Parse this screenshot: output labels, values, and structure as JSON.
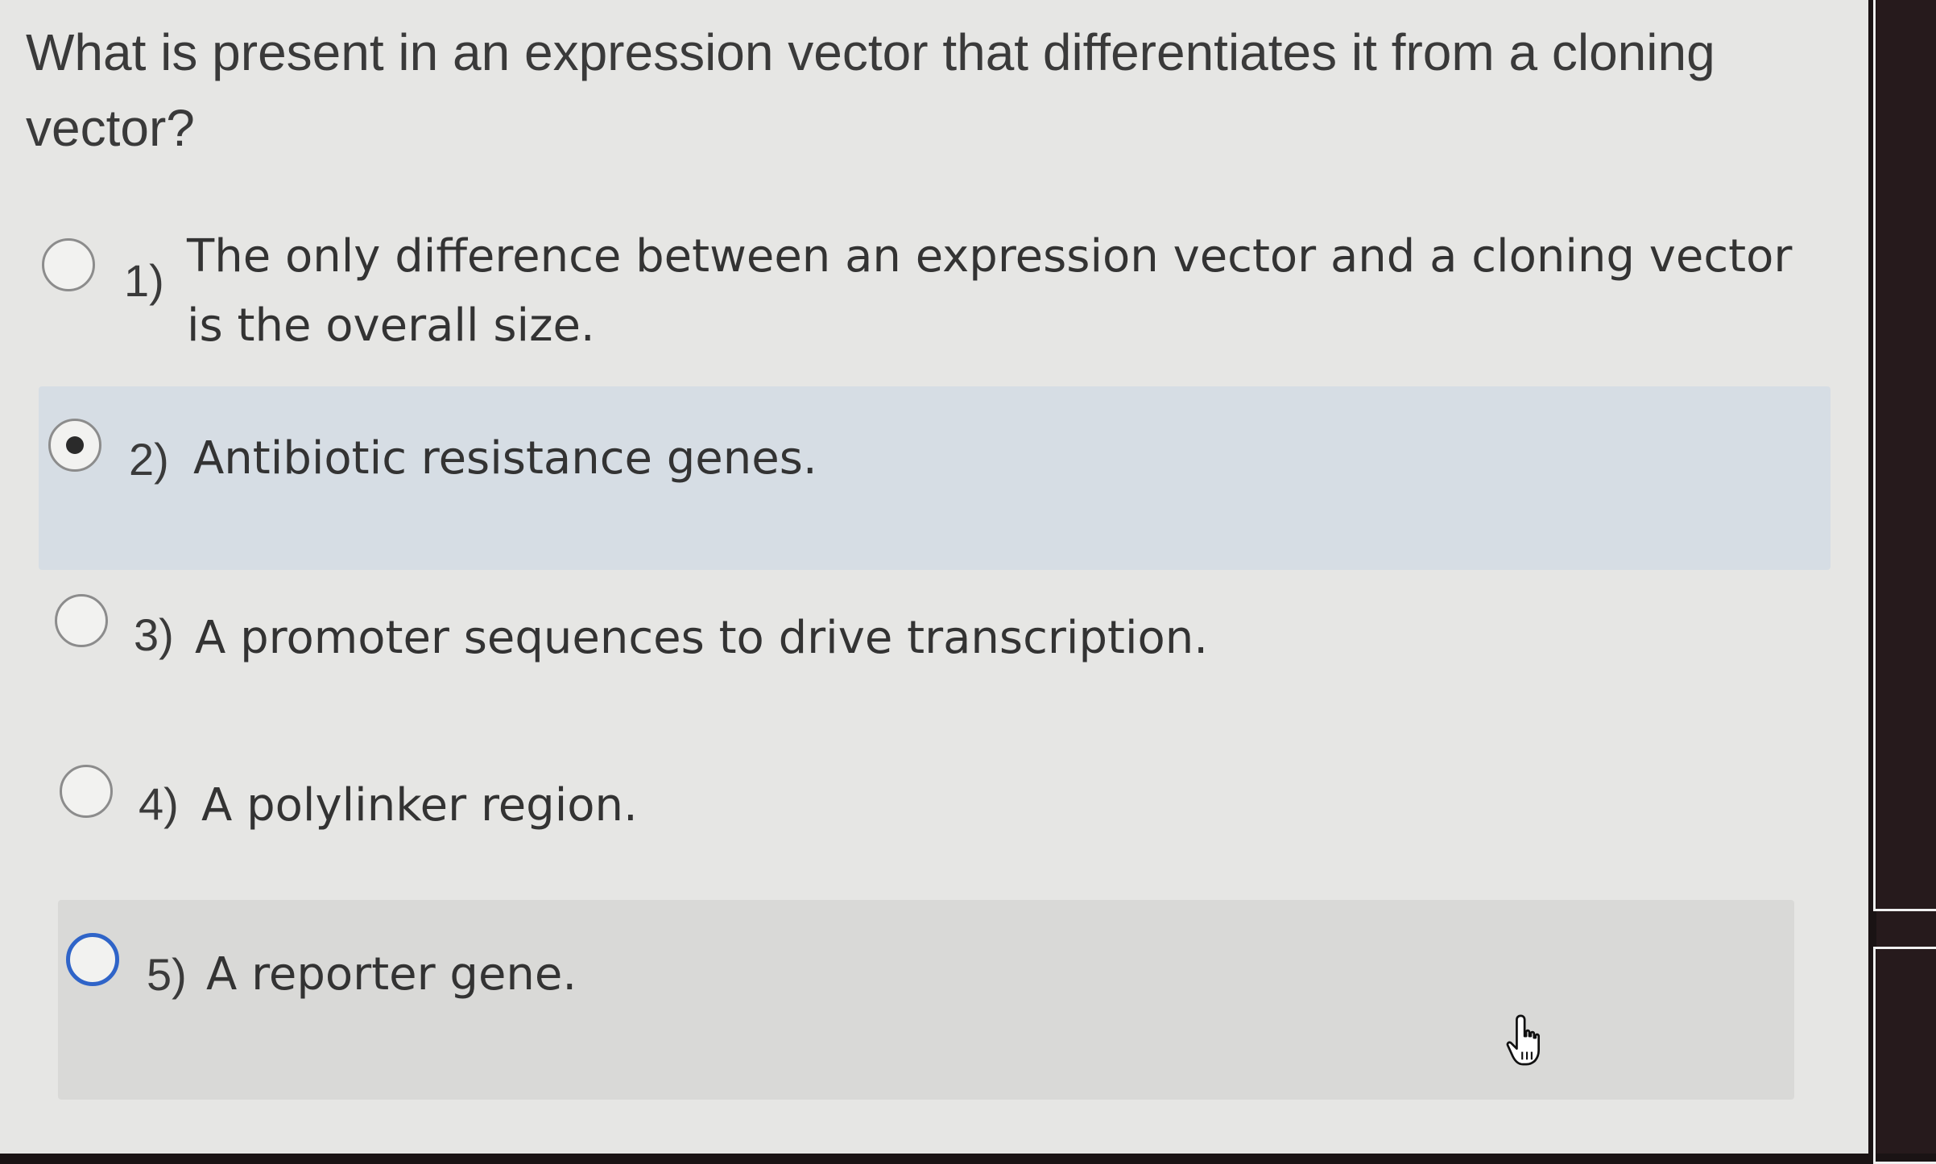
{
  "question": {
    "text": "What is present in an expression vector that differentiates it from a cloning vector?"
  },
  "options": [
    {
      "number": "1)",
      "text": "The only difference between an expression vector and a cloning vector is the overall size.",
      "selected": false
    },
    {
      "number": "2)",
      "text": "Antibiotic resistance genes.",
      "selected": true
    },
    {
      "number": "3)",
      "text": "A promoter sequences to drive transcription.",
      "selected": false
    },
    {
      "number": "4)",
      "text": "A polylinker region.",
      "selected": false
    },
    {
      "number": "5)",
      "text": "A reporter gene.",
      "selected": false,
      "focused": true
    }
  ],
  "colors": {
    "page_background": "#e6e6e4",
    "selected_row": "#d6dde4",
    "focus_ring": "#2f64c8"
  },
  "icons": {
    "pointer": "hand-pointer-icon"
  }
}
